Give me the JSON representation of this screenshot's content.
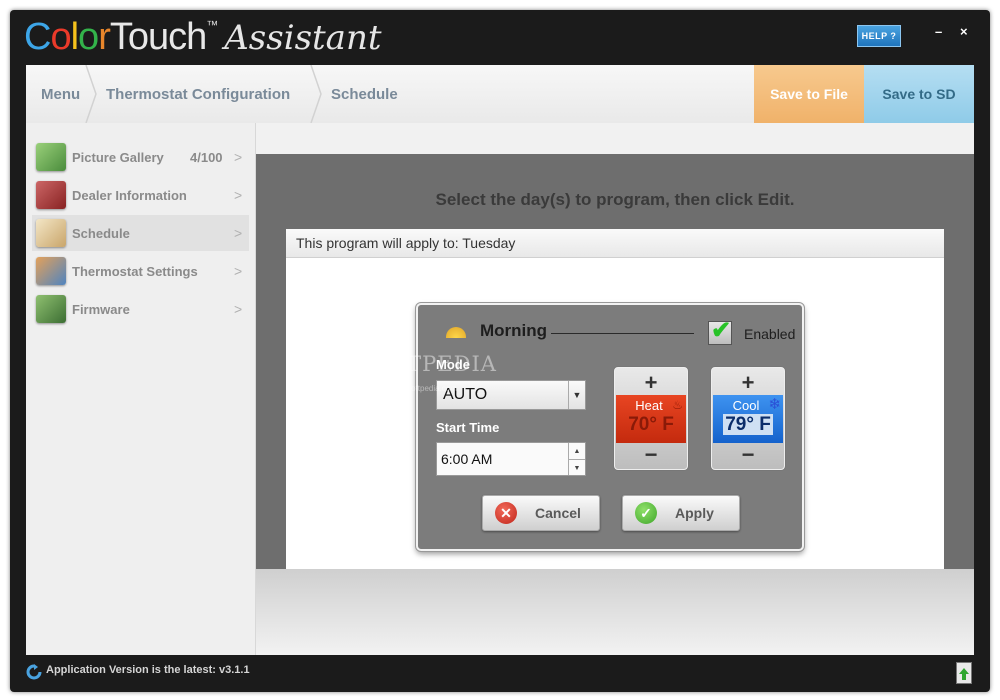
{
  "app": {
    "logo": {
      "color_letters": [
        "C",
        "o",
        "l",
        "o",
        "r"
      ],
      "color_letter_colors": [
        "#3da6e8",
        "#eb3a2a",
        "#f6c21c",
        "#33b34a",
        "#e8862b"
      ],
      "touch": "Touch",
      "tm": "™",
      "assistant": "Assistant"
    },
    "help_label": "HELP ?",
    "minimize_glyph": "–",
    "close_glyph": "×"
  },
  "breadcrumb": {
    "items": [
      {
        "label": "Menu"
      },
      {
        "label": "Thermostat Configuration"
      },
      {
        "label": "Schedule"
      }
    ],
    "save_file_label": "Save to File",
    "save_sd_label": "Save to SD"
  },
  "sidebar": {
    "items": [
      {
        "label": "Picture Gallery",
        "count": "4/100",
        "arrow": ">",
        "icon": "picture-gallery-icon"
      },
      {
        "label": "Dealer Information",
        "arrow": ">",
        "icon": "dealer-info-icon"
      },
      {
        "label": "Schedule",
        "arrow": ">",
        "icon": "calendar-icon",
        "active": true
      },
      {
        "label": "Thermostat Settings",
        "arrow": ">",
        "icon": "settings-icon"
      },
      {
        "label": "Firmware",
        "arrow": ">",
        "icon": "chip-icon"
      }
    ]
  },
  "main": {
    "instruction": "Select the day(s) to program, then click Edit.",
    "panel_header": "This program will apply to: Tuesday"
  },
  "dialog": {
    "title": "Morning",
    "enabled_label": "Enabled",
    "enabled_checked": true,
    "mode_label": "Mode",
    "mode_value": "AUTO",
    "start_time_label": "Start Time",
    "start_time_value": "6:00 AM",
    "heat": {
      "label": "Heat",
      "temp": "70° F",
      "plus": "+",
      "minus": "−"
    },
    "cool": {
      "label": "Cool",
      "temp": "79° F",
      "plus": "+",
      "minus": "−"
    },
    "cancel_label": "Cancel",
    "apply_label": "Apply"
  },
  "watermark": {
    "text": "SOFTPEDIA",
    "url": "www.softpedia.com"
  },
  "status": {
    "text": "Application Version is the latest: v3.1.1"
  },
  "colors": {
    "heat": "#d8381a",
    "cool": "#2a7ee0",
    "save_file": "#f3ba76",
    "save_sd": "#9fd2ec"
  }
}
